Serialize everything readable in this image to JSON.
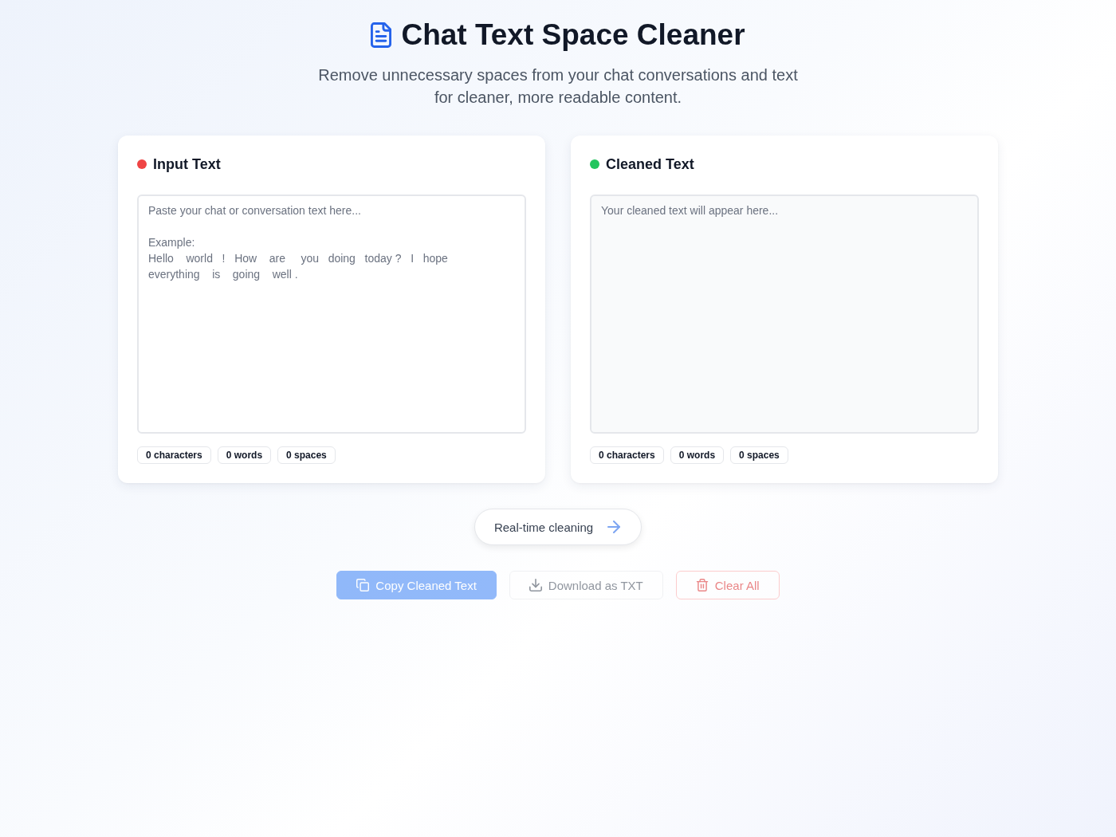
{
  "header": {
    "title": "Chat Text Space Cleaner",
    "subtitle": "Remove unnecessary spaces from your chat conversations and text for cleaner, more readable content."
  },
  "panels": [
    {
      "kind": "input",
      "title": "Input Text",
      "color": "#ef4444",
      "placeholder": "Paste your chat or conversation text here...\n\nExample:\nHello    world   !   How    are     you   doing   today ?   I   hope\neverything    is    going    well .",
      "stats": [
        "0 characters",
        "0 words",
        "0 spaces"
      ]
    },
    {
      "kind": "output",
      "title": "Cleaned Text",
      "color": "#22c55e",
      "placeholder": "Your cleaned text will appear here...",
      "stats": [
        "0 characters",
        "0 words",
        "0 spaces"
      ]
    }
  ],
  "realtime": {
    "label": "Real-time cleaning"
  },
  "actions": [
    {
      "kind": "copy",
      "label": "Copy Cleaned Text",
      "disabled": true
    },
    {
      "kind": "download",
      "label": "Download as TXT",
      "disabled": true
    },
    {
      "kind": "clear",
      "label": "Clear All",
      "disabled": true
    }
  ]
}
